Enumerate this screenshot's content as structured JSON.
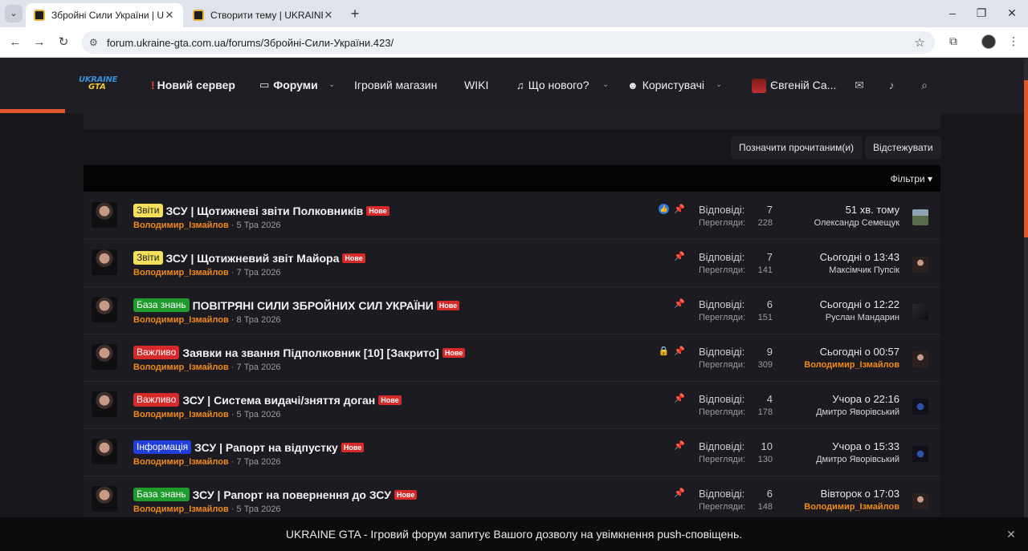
{
  "browser": {
    "tabs": [
      {
        "title": "Збройні Сили України | UKRAINE GTA",
        "active": true
      },
      {
        "title": "Створити тему | UKRAINE GTA",
        "active": false
      }
    ],
    "url": "forum.ukraine-gta.com.ua/forums/Збройні-Сили-України.423/"
  },
  "header": {
    "logo_line1": "UKRAINE",
    "logo_line2": "GTA",
    "nav": {
      "new_server": "Новий сервер",
      "forums": "Форуми",
      "shop": "Ігровий магазин",
      "wiki": "WIKI",
      "whats_new": "Що нового?",
      "members": "Користувачі",
      "user": "Євгеній Са..."
    }
  },
  "actions": {
    "mark_read": "Позначити прочитаним(и)",
    "watch": "Відстежувати",
    "filters": "Фільтри"
  },
  "stat_labels": {
    "replies": "Відповіді:",
    "views": "Перегляди:"
  },
  "threads": [
    {
      "prefix": "Звіти",
      "prefix_style": "yellow",
      "title": "ЗСУ | Щотижневі звіти Полковників",
      "badge": "Нове",
      "author": "Володимир_Ізмайлов",
      "date": "5 Тра 2026",
      "replies": "7",
      "views": "228",
      "last_when": "51 хв. тому",
      "last_user": "Олександр Семещук",
      "last_user_highlight": false,
      "last_avatar": "land",
      "liked": true,
      "locked": false
    },
    {
      "prefix": "Звіти",
      "prefix_style": "yellow",
      "title": "ЗСУ | Щотижневий звіт Майора",
      "badge": "Нове",
      "author": "Володимир_Ізмайлов",
      "date": "7 Тра 2026",
      "replies": "7",
      "views": "141",
      "last_when": "Сьогодні о 13:43",
      "last_user": "Максімчик Пупсік",
      "last_user_highlight": false,
      "last_avatar": "person",
      "liked": false,
      "locked": false
    },
    {
      "prefix": "База знань",
      "prefix_style": "green",
      "title": "ПОВІТРЯНІ СИЛИ ЗБРОЙНИХ СИЛ УКРАЇНИ",
      "badge": "Нове",
      "author": "Володимир_Ізмайлов",
      "date": "8 Тра 2026",
      "replies": "6",
      "views": "151",
      "last_when": "Сьогодні о 12:22",
      "last_user": "Руслан Мандарин",
      "last_user_highlight": false,
      "last_avatar": "dark",
      "liked": false,
      "locked": false
    },
    {
      "prefix": "Важливо",
      "prefix_style": "red",
      "title": "Заявки на звання Підполковник [10] [Закрито]",
      "badge": "Нове",
      "author": "Володимир_Ізмайлов",
      "date": "7 Тра 2026",
      "replies": "9",
      "views": "309",
      "last_when": "Сьогодні о 00:57",
      "last_user": "Володимир_Ізмайлов",
      "last_user_highlight": true,
      "last_avatar": "person",
      "liked": false,
      "locked": true
    },
    {
      "prefix": "Важливо",
      "prefix_style": "red",
      "title": "ЗСУ | Система видачі/зняття доган",
      "badge": "Нове",
      "author": "Володимир_Ізмайлов",
      "date": "5 Тра 2026",
      "replies": "4",
      "views": "178",
      "last_when": "Учора о 22:16",
      "last_user": "Дмитро Яворівський",
      "last_user_highlight": false,
      "last_avatar": "blue",
      "liked": false,
      "locked": false
    },
    {
      "prefix": "Інформація",
      "prefix_style": "blue",
      "title": "ЗСУ | Рапорт на відпустку",
      "badge": "Нове",
      "author": "Володимир_Ізмайлов",
      "date": "7 Тра 2026",
      "replies": "10",
      "views": "130",
      "last_when": "Учора о 15:33",
      "last_user": "Дмитро Яворівський",
      "last_user_highlight": false,
      "last_avatar": "blue",
      "liked": false,
      "locked": false
    },
    {
      "prefix": "База знань",
      "prefix_style": "green",
      "title": "ЗСУ | Рапорт на повернення до ЗСУ",
      "badge": "Нове",
      "author": "Володимир_Ізмайлов",
      "date": "5 Тра 2026",
      "replies": "6",
      "views": "148",
      "last_when": "Вівторок о 17:03",
      "last_user": "Володимир_Ізмайлов",
      "last_user_highlight": true,
      "last_avatar": "person",
      "liked": false,
      "locked": false
    }
  ],
  "notification": "UKRAINE GTA - Ігровий форум запитує Вашого дозволу на увімкнення push-сповіщень.",
  "colors": {
    "accent": "#e0572a",
    "author": "#f08a1a",
    "new_badge": "#d62a2a"
  }
}
